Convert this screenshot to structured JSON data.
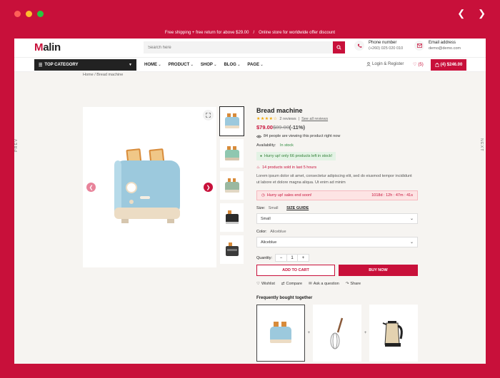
{
  "browser": {
    "dot_colors": [
      "#ff5f57",
      "#febc2e",
      "#28c840"
    ],
    "back_icon": "chevron-left-icon",
    "forward_icon": "chevron-right-icon"
  },
  "topbar": {
    "promo_left": "Free shipping + free return for above $29.00",
    "separator": "/",
    "promo_right": "Online store for worldwide offer discount"
  },
  "header": {
    "logo_first": "M",
    "logo_rest": "alin",
    "search_placeholder": "Search here",
    "phone_label": "Phone number",
    "phone_value": "(+260) 025 020 010",
    "email_label": "Email address",
    "email_value": "demo@demo.com"
  },
  "nav": {
    "top_category": "TOP CATEGORY",
    "menu": [
      "HOME",
      "PRODUCT",
      "SHOP",
      "BLOG",
      "PAGE"
    ],
    "login": "Login & Register",
    "wishlist_count": "(5)",
    "cart": "(4) $246.00"
  },
  "breadcrumb": "Home / Bread machine",
  "side": {
    "prev": "PREV",
    "next": "NEXT"
  },
  "product": {
    "title": "Bread machine",
    "stars": "★★★★☆",
    "reviews": "2 reviews",
    "review_link": "See all reviews",
    "price_new": "$79.00",
    "price_old": "$89.00",
    "discount": "(-11%)",
    "viewing": "84 people are viewing this product right now",
    "availability_label": "Availability:",
    "availability_value": "In stock",
    "hurry": "Hurry up! only 66 products left in stock!",
    "sold": "14 products sold in last 5 hours",
    "description": "Lorem ipsum dolor sit amet, consectetur adipiscing elit, sed do eiusmod tempor incididunt ut labore et dolore magna aliqua. Ut enim ad minim",
    "sale_text": "Hurry up! sales end soon!",
    "countdown": "1018d : 12h : 47m : 41s",
    "size_label": "Size:",
    "size_value": "Small",
    "size_guide": "SIZE GUIDE",
    "size_selected": "Small",
    "color_label": "Color:",
    "color_value": "Aliceblue",
    "color_selected": "Aliceblue",
    "qty_label": "Quantity:",
    "qty_minus": "−",
    "qty_value": "1",
    "qty_plus": "+",
    "add_to_cart": "ADD TO CART",
    "buy_now": "BUY NOW",
    "wishlist": "Wishlist",
    "compare": "Compare",
    "ask": "Ask a question",
    "share": "Share",
    "fbt_title": "Frequently bought together"
  },
  "colors": {
    "brand": "#c8103a",
    "toaster_body": "#9cc9dd",
    "toaster_base": "#ecdcc4",
    "bread": "#d88b3a"
  }
}
